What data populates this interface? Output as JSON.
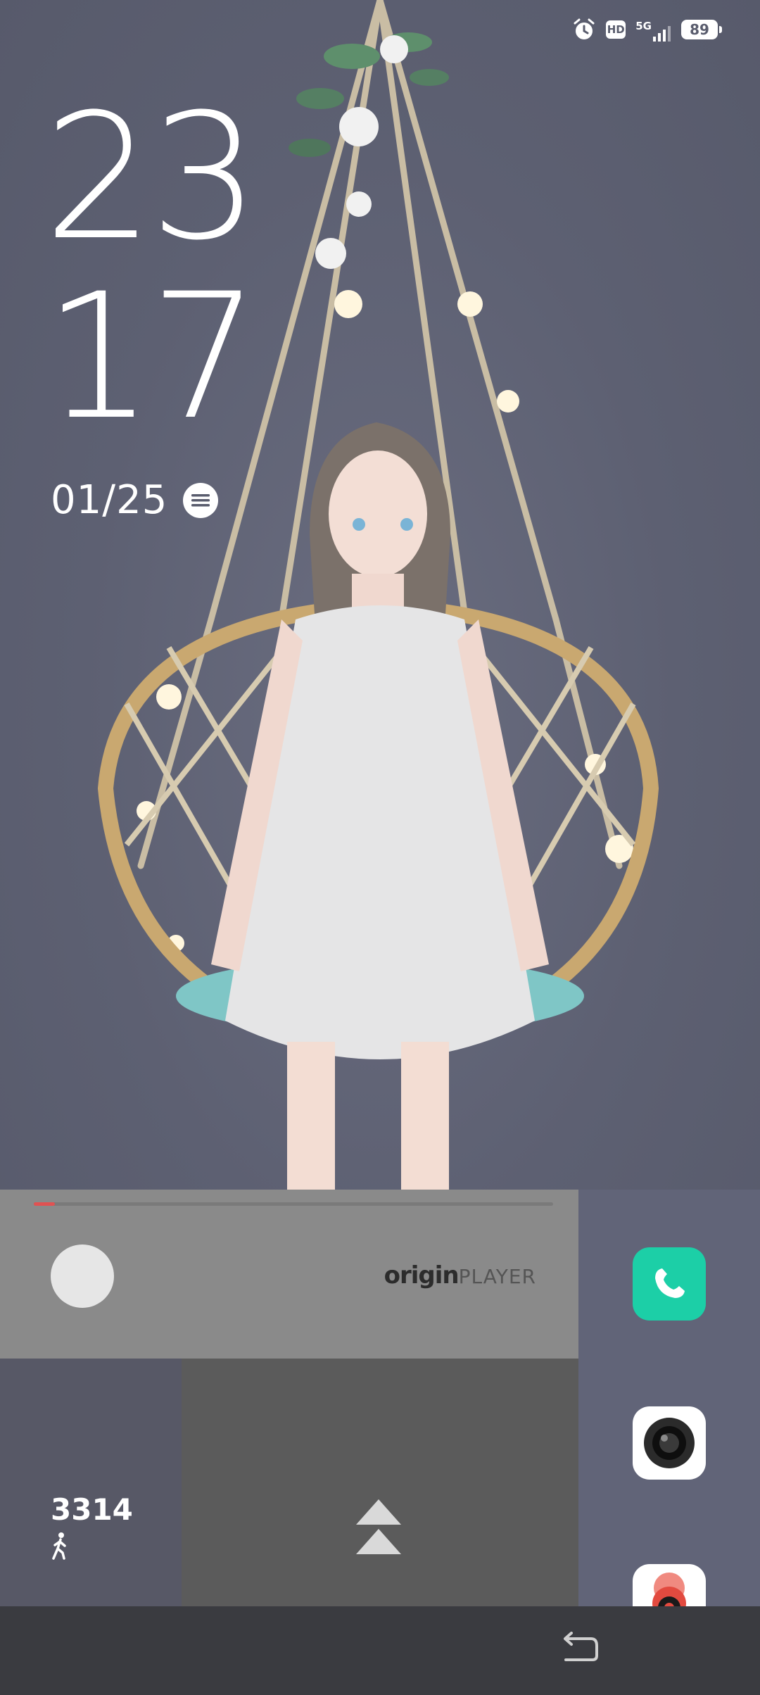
{
  "status_bar": {
    "hd": "HD",
    "network": "5G",
    "battery": "89"
  },
  "lock_screen": {
    "hours": "23",
    "minutes": "17",
    "date": "01/25"
  },
  "player_widget": {
    "logo_origin": "origin",
    "logo_player": "PLAYER",
    "progress": 0.04
  },
  "steps_widget": {
    "count": "3314"
  },
  "dock": {
    "apps": [
      "phone",
      "camera",
      "app"
    ]
  },
  "colors": {
    "phone_app": "#1ccfa7",
    "progress": "#e05252",
    "logo_accent": "#e03030"
  }
}
